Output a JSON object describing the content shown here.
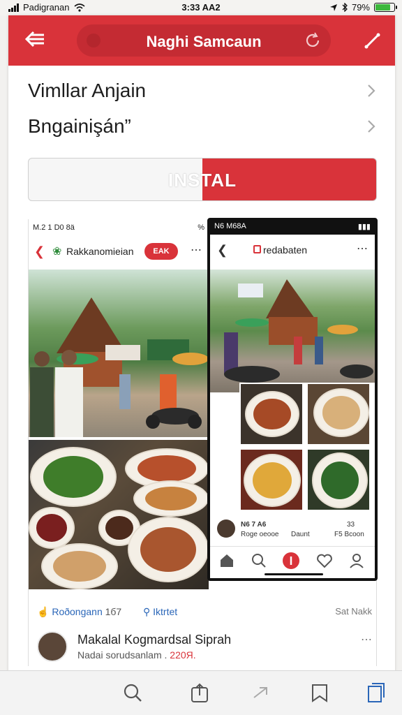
{
  "status_bar": {
    "carrier": "Padigranan",
    "time": "3:33 AA2",
    "battery": "79%",
    "battery_level": 0.79
  },
  "header": {
    "title": "Naghi Samcaun",
    "accent_color": "#d9333a",
    "icons": [
      "back-arrow-icon",
      "reload-icon",
      "edit-icon"
    ]
  },
  "menu": {
    "items": [
      {
        "label": "Vimllar Anjain"
      },
      {
        "label": "Bngainişán”"
      }
    ]
  },
  "install": {
    "label": "INSTAL",
    "progress": 0.5
  },
  "preview": {
    "left_phone": {
      "status_time": "M.2 1 D0 8ä",
      "status_right": "%",
      "title": "Rakkanomieian",
      "badge": "EAK"
    },
    "right_phone": {
      "status_time": "N6 M68A",
      "title": "redabaten",
      "profile_name": "N6 7 A6",
      "profile_sub": "Roge oeooe",
      "stat_1_label": "Daunt",
      "stat_2_value": "33",
      "stat_2_label": "F5 Bcoon"
    },
    "meta": {
      "location": "Roðongann",
      "location_count": "1б7",
      "market": "Iktrtet",
      "side_text": "Sat Nakk"
    },
    "user": {
      "name": "Makalal Kogmardsal Siprah",
      "subtitle": "Nadai sorudsanlam .",
      "price": "220Я."
    }
  },
  "toolbar": {
    "items": [
      "search-icon",
      "share-icon",
      "forward-icon",
      "bookmarks-icon",
      "tabs-icon"
    ]
  }
}
